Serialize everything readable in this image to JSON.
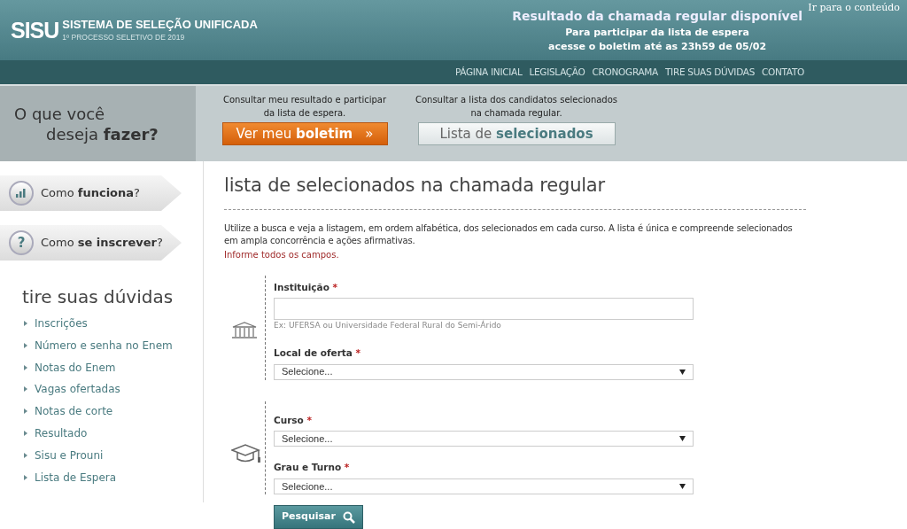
{
  "header": {
    "logo": "SISU",
    "system_name": "SISTEMA DE SELEÇÃO UNIFICADA",
    "subtitle": "1º PROCESSO SELETIVO DE 2019",
    "notice_title": "Resultado da chamada regular disponível",
    "notice_lines": [
      "Para participar da lista de espera",
      "acesse o boletim até as 23h59 de 05/02"
    ],
    "skip_link": "Ir para o conteúdo"
  },
  "nav": [
    "PÁGINA INICIAL",
    "LEGISLAÇÃO",
    "CRONOGRAMA",
    "TIRE SUAS DÚVIDAS",
    "CONTATO"
  ],
  "actions": {
    "question_lines": [
      "O que você",
      "deseja **fazer?**"
    ],
    "items": [
      {
        "kind": "primary",
        "description": "Consultar meu resultado e participar da lista de espera.",
        "button": "Ver meu **boletim**",
        "arrow": "»"
      },
      {
        "kind": "secondary",
        "description": "Consultar a lista dos candidatos selecionados na chamada regular.",
        "button": "Lista de **selecionados**"
      }
    ]
  },
  "sidebar": {
    "tabs": [
      {
        "label": "Como **funciona**?"
      },
      {
        "label": "Como **se inscrever**?",
        "icon_text": "?"
      }
    ],
    "faq_title": "tire suas dúvidas",
    "faq_items": [
      "Inscrições",
      "Número e senha no Enem",
      "Notas do Enem",
      "Vagas ofertadas",
      "Notas de corte",
      "Resultado",
      "Sisu e Prouni",
      "Lista de Espera"
    ]
  },
  "content": {
    "title": "lista de selecionados na chamada regular",
    "intro": "Utilize a busca e veja a listagem, em ordem alfabética, dos selecionados em cada curso. A lista é única e compreende selecionados em ampla concorrência e ações afirmativas.",
    "warning": "Informe todos os campos.",
    "groups": [
      {
        "fields": [
          {
            "kind": "text",
            "label": "Instituição",
            "required_mark": "*",
            "help": "Ex: UFERSA ou Universidade Federal Rural do Semi-Árido"
          },
          {
            "kind": "select",
            "label": "Local de oferta",
            "required_mark": "*",
            "value": "Selecione..."
          }
        ]
      },
      {
        "fields": [
          {
            "kind": "select",
            "label": "Curso",
            "required_mark": "*",
            "value": "Selecione..."
          },
          {
            "kind": "select",
            "label": "Grau e Turno",
            "required_mark": "*",
            "value": "Selecione..."
          }
        ]
      }
    ],
    "submit": "Pesquisar"
  }
}
